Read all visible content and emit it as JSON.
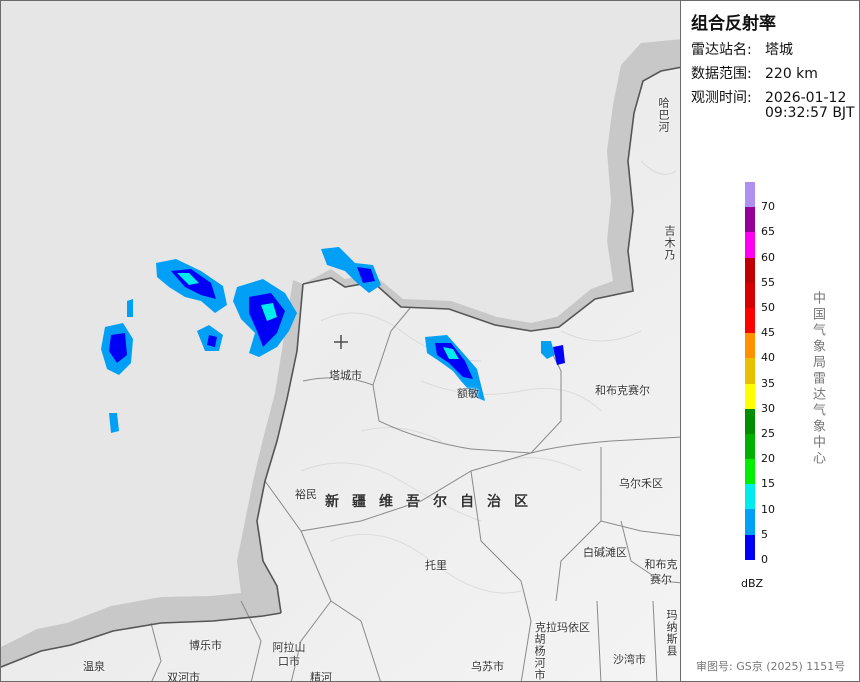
{
  "panel": {
    "title": "组合反射率",
    "station_label": "雷达站名:",
    "station_value": "塔城",
    "range_label": "数据范围:",
    "range_value": "220 km",
    "time_label": "观测时间:",
    "time_date": "2026-01-12",
    "time_clock": "09:32:57 BJT",
    "legend_unit": "dBZ",
    "legend_values": [
      "70",
      "65",
      "60",
      "55",
      "50",
      "45",
      "40",
      "35",
      "30",
      "25",
      "20",
      "15",
      "10",
      "5",
      "0"
    ],
    "legend_colors": [
      "#ad90f0",
      "#960096",
      "#ff00f0",
      "#c00000",
      "#d60000",
      "#ff0000",
      "#ff9000",
      "#e7c000",
      "#ffff00",
      "#008e00",
      "#00b000",
      "#00ee00",
      "#00ecec",
      "#01a0f6",
      "#0000f6"
    ],
    "credit": "中国气象局雷达气象中心",
    "review_number": "审图号: GS京 (2025) 1151号"
  },
  "map": {
    "radar_site_icon": "crosshair-icon",
    "places": {
      "tacheng": "塔城市",
      "emin": "额敏",
      "hobukesaier": "和布克赛尔",
      "yumin": "裕民",
      "wuerhe": "乌尔禾区",
      "baijiantan": "白碱滩区",
      "hobukesaier2": "和布克赛尔",
      "tuoli": "托里",
      "kelamayi": "克拉玛依区",
      "bole": "博乐市",
      "alashankou": "阿拉山口市",
      "wenquan": "温泉",
      "shuanghe": "双河市",
      "jinghe": "精河",
      "wusu": "乌苏市",
      "huyanghe": "胡杨河市",
      "shawan": "沙湾市",
      "manasi": "玛纳斯县",
      "habahe": "哈巴河",
      "jimunai": "吉木乃"
    },
    "region": "新疆维吾尔自治区"
  }
}
